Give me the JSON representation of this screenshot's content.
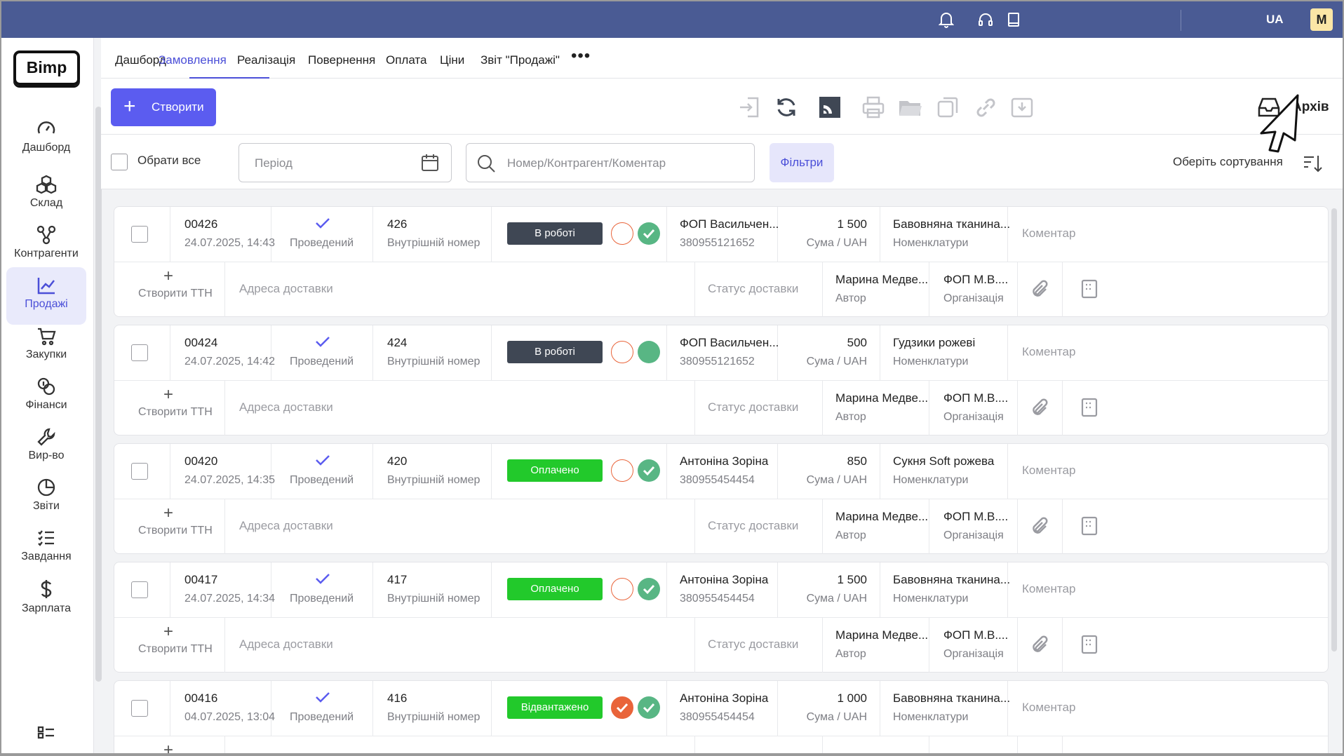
{
  "header": {
    "language": "UA",
    "avatar_letter": "M"
  },
  "logo": "Bimp",
  "sidebar": {
    "items": [
      {
        "label": "Дашборд",
        "icon": "speedometer-icon"
      },
      {
        "label": "Склад",
        "icon": "boxes-icon"
      },
      {
        "label": "Контрагенти",
        "icon": "network-icon"
      },
      {
        "label": "Продажі",
        "icon": "chart-line-icon",
        "active": true
      },
      {
        "label": "Закупки",
        "icon": "cart-icon"
      },
      {
        "label": "Фінанси",
        "icon": "coins-icon"
      },
      {
        "label": "Вир-во",
        "icon": "wrench-icon"
      },
      {
        "label": "Звіти",
        "icon": "pie-chart-icon"
      },
      {
        "label": "Завдання",
        "icon": "tasks-icon"
      },
      {
        "label": "Зарплата",
        "icon": "dollar-icon"
      }
    ]
  },
  "tabs": [
    {
      "label": "Дашборд"
    },
    {
      "label": "Замовлення",
      "active": true
    },
    {
      "label": "Реалізація"
    },
    {
      "label": "Повернення"
    },
    {
      "label": "Оплата"
    },
    {
      "label": "Ціни"
    },
    {
      "label": "Звіт \"Продажі\""
    }
  ],
  "toolbar": {
    "create_label": "Створити",
    "archive_label": "Архів"
  },
  "filters": {
    "select_all": "Обрати все",
    "period_placeholder": "Період",
    "search_placeholder": "Номер/Контрагент/Коментар",
    "filters_label": "Фільтри",
    "sort_label": "Оберіть сортування"
  },
  "labels": {
    "conducted": "Проведений",
    "internal_number": "Внутрішній номер",
    "amount_suffix": "Сума / UAH",
    "nomenclature": "Номенклатури",
    "comment": "Коментар",
    "create_ttn": "Створити ТТН",
    "delivery_address": "Адреса доставки",
    "delivery_status": "Статус доставки",
    "author": "Автор",
    "organization": "Організація"
  },
  "colors": {
    "accent": "#5b5cf0",
    "topbar": "#4a5b94",
    "status_in_work": "#3f4754",
    "status_paid": "#22c92b",
    "green_check": "#58b684",
    "orange": "#e9643a"
  },
  "orders": [
    {
      "number": "00426",
      "date": "24.07.2025, 14:43",
      "internal": "426",
      "status": "В роботі",
      "status_type": "work",
      "orange_done": false,
      "green_checked": true,
      "counterparty": "ФОП Васильчен...",
      "phone": "380955121652",
      "amount": "1 500",
      "product": "Бавовняна тканина...",
      "author": "Марина Медве...",
      "org": "ФОП М.В...."
    },
    {
      "number": "00424",
      "date": "24.07.2025, 14:42",
      "internal": "424",
      "status": "В роботі",
      "status_type": "work",
      "orange_done": false,
      "green_checked": false,
      "counterparty": "ФОП Васильчен...",
      "phone": "380955121652",
      "amount": "500",
      "product": "Гудзики рожеві",
      "author": "Марина Медве...",
      "org": "ФОП М.В...."
    },
    {
      "number": "00420",
      "date": "24.07.2025, 14:35",
      "internal": "420",
      "status": "Оплачено",
      "status_type": "paid",
      "orange_done": false,
      "green_checked": true,
      "counterparty": "Антоніна Зоріна",
      "phone": "380955454454",
      "amount": "850",
      "product": "Сукня Soft рожева",
      "author": "Марина Медве...",
      "org": "ФОП М.В...."
    },
    {
      "number": "00417",
      "date": "24.07.2025, 14:34",
      "internal": "417",
      "status": "Оплачено",
      "status_type": "paid",
      "orange_done": false,
      "green_checked": true,
      "counterparty": "Антоніна Зоріна",
      "phone": "380955454454",
      "amount": "1 500",
      "product": "Бавовняна тканина...",
      "author": "Марина Медве...",
      "org": "ФОП М.В...."
    },
    {
      "number": "00416",
      "date": "04.07.2025, 13:04",
      "internal": "416",
      "status": "Відвантажено",
      "status_type": "paid",
      "orange_done": true,
      "green_checked": true,
      "counterparty": "Антоніна Зоріна",
      "phone": "380955454454",
      "amount": "1 000",
      "product": "Бавовняна тканина...",
      "author": "",
      "org": ""
    }
  ]
}
